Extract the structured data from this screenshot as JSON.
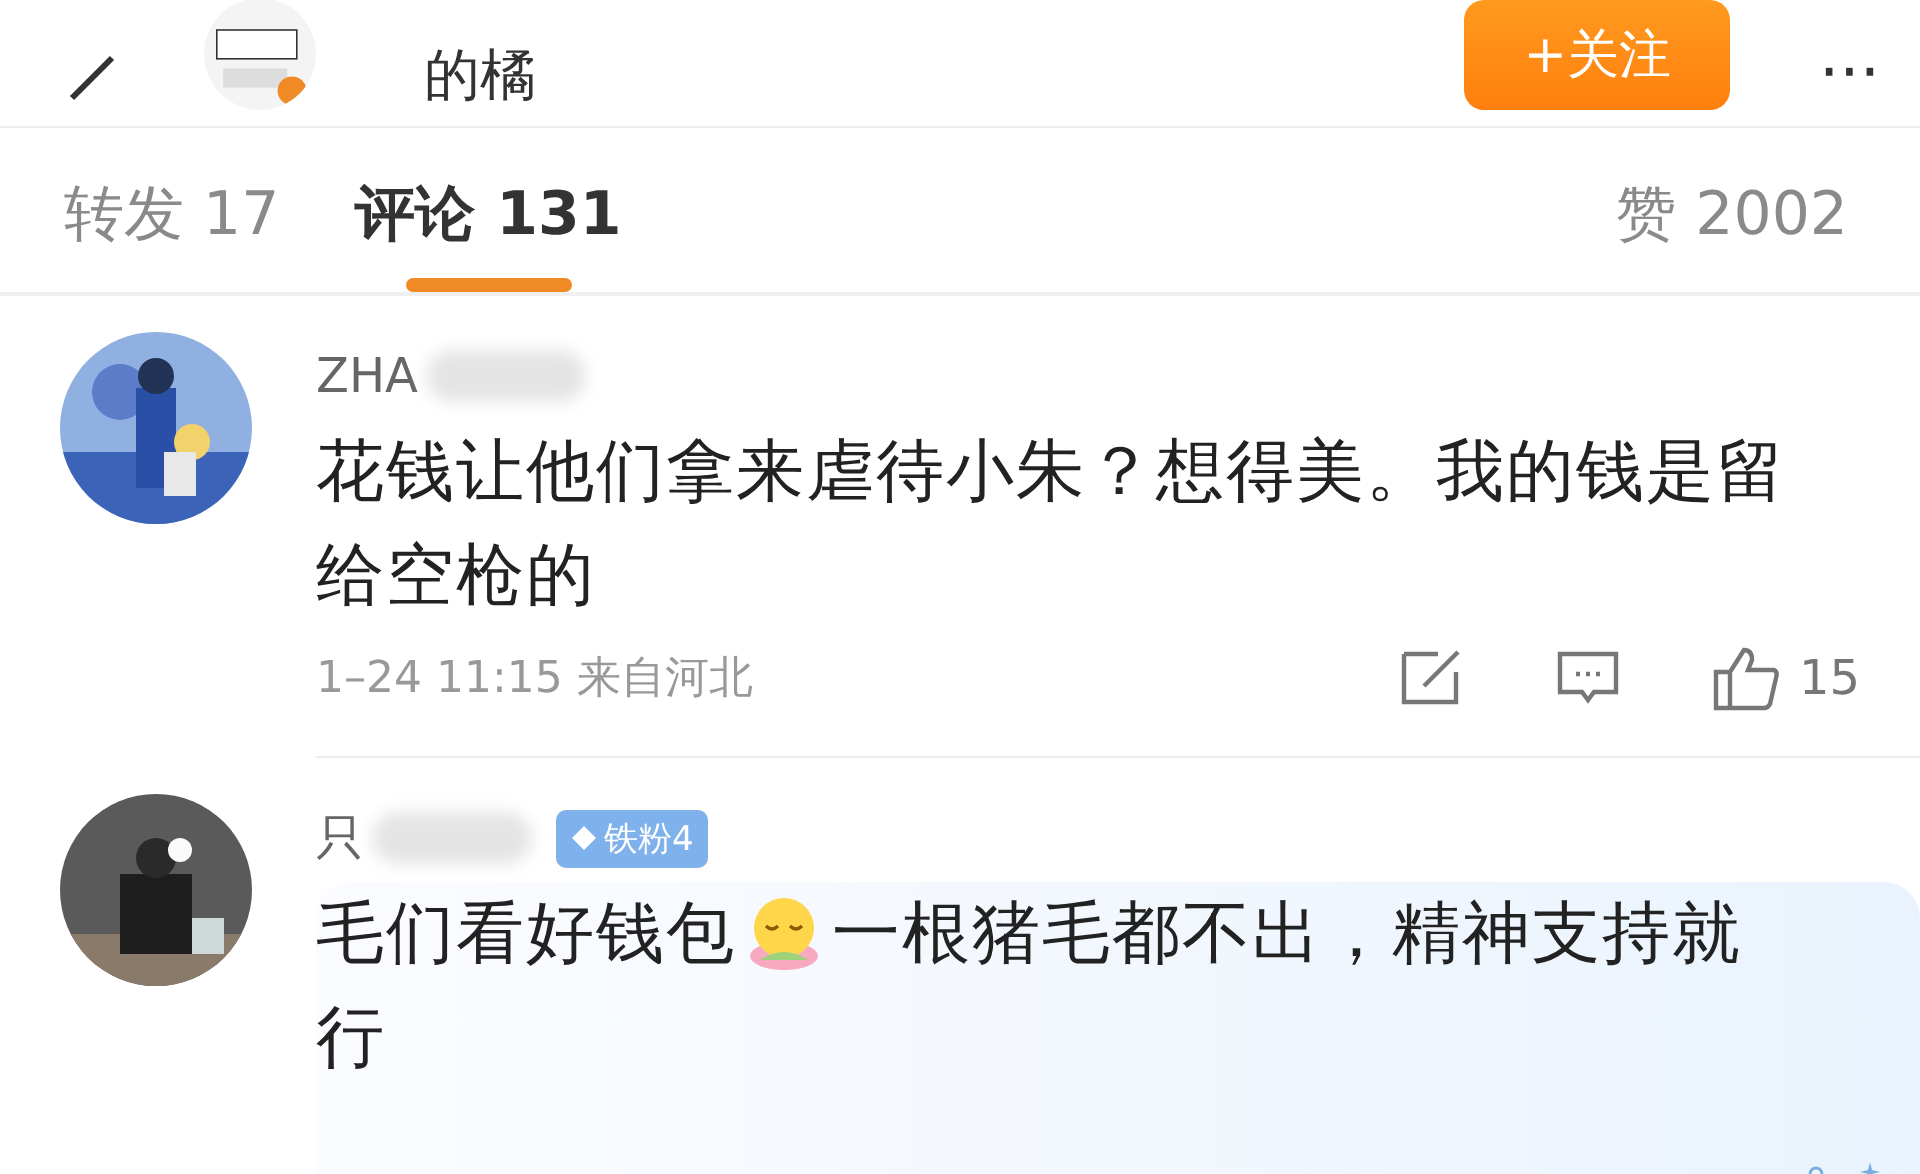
{
  "header": {
    "title": "的橘",
    "follow_button": "+关注",
    "menu": "···"
  },
  "tabs": [
    {
      "label": "转发",
      "count": "17",
      "selected": false
    },
    {
      "label": "评论",
      "count": "131",
      "selected": true
    },
    {
      "label": "赞",
      "count": "2002",
      "selected": false
    }
  ],
  "comments": [
    {
      "name": "ZHA",
      "decorated": false,
      "body": [
        {
          "kind": "text",
          "text": "花钱让他们拿来虐待小朱？想得美。我的钱是留给空枪的"
        }
      ],
      "time": "1–24 11:15",
      "location": "来自河北",
      "likes": "15"
    },
    {
      "name": "只",
      "badge": "铁粉4",
      "decorated": true,
      "body": [
        {
          "kind": "text",
          "text": "毛们看好钱包"
        },
        {
          "kind": "emoji"
        },
        {
          "kind": "text",
          "text": "一根猪毛都不出，精神支持就行"
        }
      ]
    }
  ]
}
